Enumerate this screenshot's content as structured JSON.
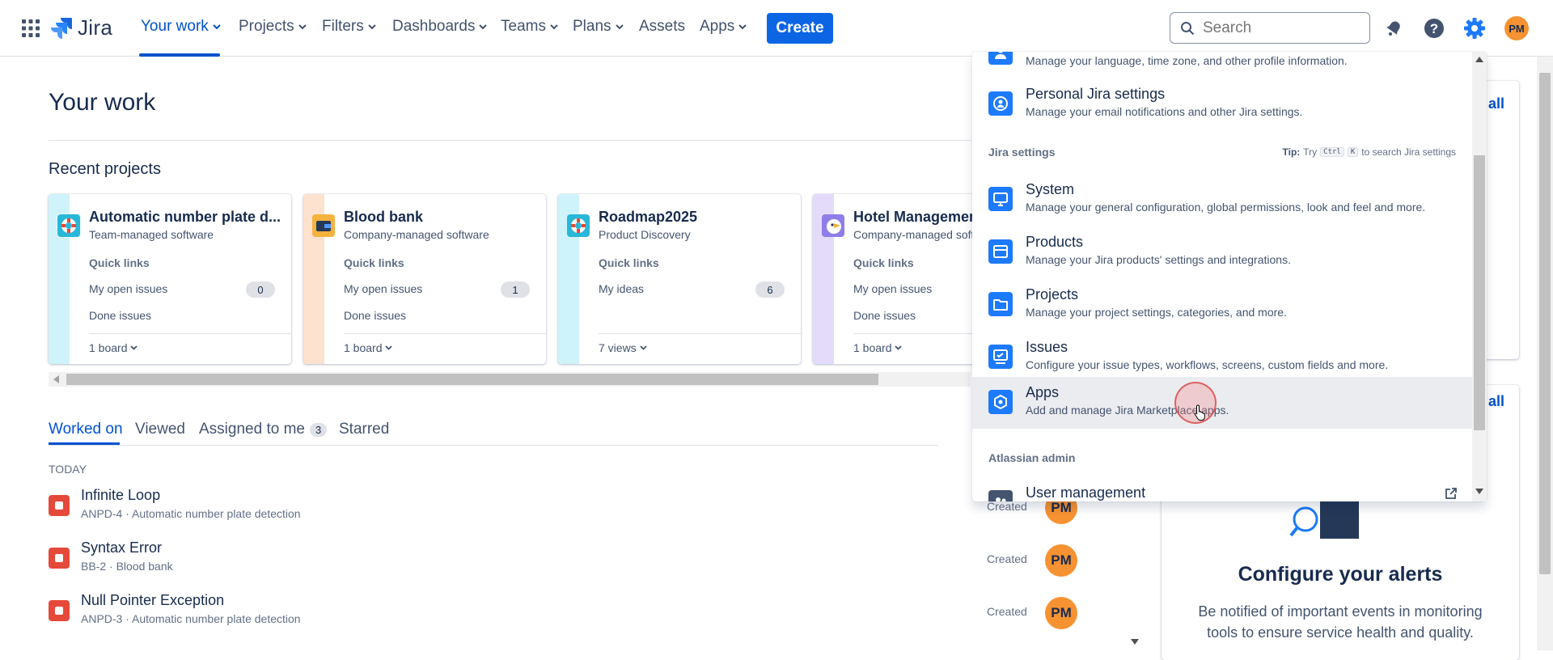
{
  "nav": {
    "logo": "Jira",
    "items": [
      {
        "label": "Your work",
        "active": true
      },
      {
        "label": "Projects",
        "dropdown": true
      },
      {
        "label": "Filters",
        "dropdown": true
      },
      {
        "label": "Dashboards",
        "dropdown": true
      },
      {
        "label": "Teams",
        "dropdown": true
      },
      {
        "label": "Plans",
        "dropdown": true
      },
      {
        "label": "Assets",
        "dropdown": false
      },
      {
        "label": "Apps",
        "dropdown": true
      }
    ],
    "create_label": "Create",
    "search_placeholder": "Search",
    "avatar_initials": "PM",
    "icons": [
      "app-switcher-icon",
      "notifications-icon",
      "help-icon",
      "settings-icon"
    ]
  },
  "main": {
    "title": "Your work",
    "recent_projects_title": "Recent projects",
    "projects": [
      {
        "name": "Automatic number plate d...",
        "type": "Team-managed software",
        "quick_links": "Quick links",
        "rows": [
          {
            "label": "My open issues",
            "count": "0"
          },
          {
            "label": "Done issues",
            "count": null
          }
        ],
        "footer": "1 board",
        "strip_color": "#cff3fb",
        "icon": "lifebuoy-icon"
      },
      {
        "name": "Blood bank",
        "type": "Company-managed software",
        "quick_links": "Quick links",
        "rows": [
          {
            "label": "My open issues",
            "count": "1"
          },
          {
            "label": "Done issues",
            "count": null
          }
        ],
        "footer": "1 board",
        "strip_color": "#fde2cf",
        "icon": "wallet-icon"
      },
      {
        "name": "Roadmap2025",
        "type": "Product Discovery",
        "quick_links": "Quick links",
        "rows": [
          {
            "label": "My ideas",
            "count": "6"
          }
        ],
        "footer": "7 views",
        "strip_color": "#cff3fb",
        "icon": "lifebuoy-icon"
      },
      {
        "name": "Hotel Managemen",
        "type": "Company-managed soft",
        "quick_links": "Quick links",
        "rows": [
          {
            "label": "My open issues",
            "count": null
          },
          {
            "label": "Done issues",
            "count": null
          }
        ],
        "footer": "1 board",
        "strip_color": "#e4dbfb",
        "icon": "bird-icon"
      }
    ],
    "tabs": [
      {
        "label": "Worked on",
        "active": true
      },
      {
        "label": "Viewed"
      },
      {
        "label": "Assigned to me",
        "badge": "3"
      },
      {
        "label": "Starred"
      }
    ],
    "group_label": "TODAY",
    "issues": [
      {
        "title": "Infinite Loop",
        "key": "ANPD-4",
        "project": "Automatic number plate detection",
        "status": "Created",
        "avatar": "PM"
      },
      {
        "title": "Syntax Error",
        "key": "BB-2",
        "project": "Blood bank",
        "status": "Created",
        "avatar": "PM"
      },
      {
        "title": "Null Pointer Exception",
        "key": "ANPD-3",
        "project": "Automatic number plate detection",
        "status": "Created",
        "avatar": "PM"
      }
    ]
  },
  "right_panel": {
    "view_all_1": "all",
    "view_all_2": "all",
    "alerts_title": "Configure your alerts",
    "alerts_desc": "Be notified of important events in monitoring tools to ensure service health and quality."
  },
  "settings_menu": {
    "top_partial_desc": "Manage your language, time zone, and other profile information.",
    "personal": {
      "title": "Personal Jira settings",
      "desc": "Manage your email notifications and other Jira settings.",
      "icon": "user-circle-icon"
    },
    "jira_settings_header": "Jira settings",
    "tip_label": "Tip:",
    "tip_try": "Try",
    "tip_key1": "Ctrl",
    "tip_key2": "K",
    "tip_rest": "to search Jira settings",
    "items": [
      {
        "title": "System",
        "desc": "Manage your general configuration, global permissions, look and feel and more.",
        "icon": "monitor-icon"
      },
      {
        "title": "Products",
        "desc": "Manage your Jira products' settings and integrations.",
        "icon": "product-icon"
      },
      {
        "title": "Projects",
        "desc": "Manage your project settings, categories, and more.",
        "icon": "folder-icon"
      },
      {
        "title": "Issues",
        "desc": "Configure your issue types, workflows, screens, custom fields and more.",
        "icon": "issues-icon"
      },
      {
        "title": "Apps",
        "desc": "Add and manage Jira Marketplace apps.",
        "icon": "apps-icon"
      }
    ],
    "atlassian_admin_header": "Atlassian admin",
    "user_management": {
      "title": "User management",
      "icon": "people-icon"
    }
  },
  "colors": {
    "accent": "#0052cc",
    "create": "#0c66e4",
    "avatar": "#f79232",
    "issue_bug": "#e5493a",
    "menu_icon": "#1d7afc"
  }
}
